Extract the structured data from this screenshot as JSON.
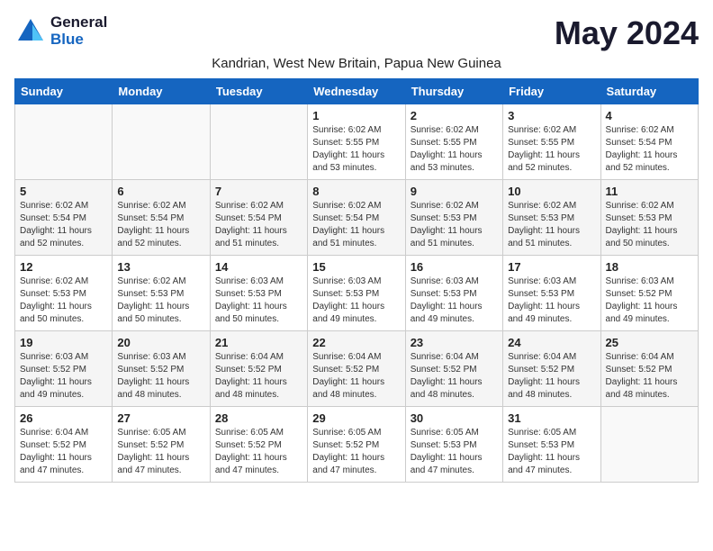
{
  "header": {
    "logo_general": "General",
    "logo_blue": "Blue",
    "month_title": "May 2024",
    "subtitle": "Kandrian, West New Britain, Papua New Guinea"
  },
  "weekdays": [
    "Sunday",
    "Monday",
    "Tuesday",
    "Wednesday",
    "Thursday",
    "Friday",
    "Saturday"
  ],
  "weeks": [
    [
      {
        "day": "",
        "info": ""
      },
      {
        "day": "",
        "info": ""
      },
      {
        "day": "",
        "info": ""
      },
      {
        "day": "1",
        "info": "Sunrise: 6:02 AM\nSunset: 5:55 PM\nDaylight: 11 hours and 53 minutes."
      },
      {
        "day": "2",
        "info": "Sunrise: 6:02 AM\nSunset: 5:55 PM\nDaylight: 11 hours and 53 minutes."
      },
      {
        "day": "3",
        "info": "Sunrise: 6:02 AM\nSunset: 5:55 PM\nDaylight: 11 hours and 52 minutes."
      },
      {
        "day": "4",
        "info": "Sunrise: 6:02 AM\nSunset: 5:54 PM\nDaylight: 11 hours and 52 minutes."
      }
    ],
    [
      {
        "day": "5",
        "info": "Sunrise: 6:02 AM\nSunset: 5:54 PM\nDaylight: 11 hours and 52 minutes."
      },
      {
        "day": "6",
        "info": "Sunrise: 6:02 AM\nSunset: 5:54 PM\nDaylight: 11 hours and 52 minutes."
      },
      {
        "day": "7",
        "info": "Sunrise: 6:02 AM\nSunset: 5:54 PM\nDaylight: 11 hours and 51 minutes."
      },
      {
        "day": "8",
        "info": "Sunrise: 6:02 AM\nSunset: 5:54 PM\nDaylight: 11 hours and 51 minutes."
      },
      {
        "day": "9",
        "info": "Sunrise: 6:02 AM\nSunset: 5:53 PM\nDaylight: 11 hours and 51 minutes."
      },
      {
        "day": "10",
        "info": "Sunrise: 6:02 AM\nSunset: 5:53 PM\nDaylight: 11 hours and 51 minutes."
      },
      {
        "day": "11",
        "info": "Sunrise: 6:02 AM\nSunset: 5:53 PM\nDaylight: 11 hours and 50 minutes."
      }
    ],
    [
      {
        "day": "12",
        "info": "Sunrise: 6:02 AM\nSunset: 5:53 PM\nDaylight: 11 hours and 50 minutes."
      },
      {
        "day": "13",
        "info": "Sunrise: 6:02 AM\nSunset: 5:53 PM\nDaylight: 11 hours and 50 minutes."
      },
      {
        "day": "14",
        "info": "Sunrise: 6:03 AM\nSunset: 5:53 PM\nDaylight: 11 hours and 50 minutes."
      },
      {
        "day": "15",
        "info": "Sunrise: 6:03 AM\nSunset: 5:53 PM\nDaylight: 11 hours and 49 minutes."
      },
      {
        "day": "16",
        "info": "Sunrise: 6:03 AM\nSunset: 5:53 PM\nDaylight: 11 hours and 49 minutes."
      },
      {
        "day": "17",
        "info": "Sunrise: 6:03 AM\nSunset: 5:53 PM\nDaylight: 11 hours and 49 minutes."
      },
      {
        "day": "18",
        "info": "Sunrise: 6:03 AM\nSunset: 5:52 PM\nDaylight: 11 hours and 49 minutes."
      }
    ],
    [
      {
        "day": "19",
        "info": "Sunrise: 6:03 AM\nSunset: 5:52 PM\nDaylight: 11 hours and 49 minutes."
      },
      {
        "day": "20",
        "info": "Sunrise: 6:03 AM\nSunset: 5:52 PM\nDaylight: 11 hours and 48 minutes."
      },
      {
        "day": "21",
        "info": "Sunrise: 6:04 AM\nSunset: 5:52 PM\nDaylight: 11 hours and 48 minutes."
      },
      {
        "day": "22",
        "info": "Sunrise: 6:04 AM\nSunset: 5:52 PM\nDaylight: 11 hours and 48 minutes."
      },
      {
        "day": "23",
        "info": "Sunrise: 6:04 AM\nSunset: 5:52 PM\nDaylight: 11 hours and 48 minutes."
      },
      {
        "day": "24",
        "info": "Sunrise: 6:04 AM\nSunset: 5:52 PM\nDaylight: 11 hours and 48 minutes."
      },
      {
        "day": "25",
        "info": "Sunrise: 6:04 AM\nSunset: 5:52 PM\nDaylight: 11 hours and 48 minutes."
      }
    ],
    [
      {
        "day": "26",
        "info": "Sunrise: 6:04 AM\nSunset: 5:52 PM\nDaylight: 11 hours and 47 minutes."
      },
      {
        "day": "27",
        "info": "Sunrise: 6:05 AM\nSunset: 5:52 PM\nDaylight: 11 hours and 47 minutes."
      },
      {
        "day": "28",
        "info": "Sunrise: 6:05 AM\nSunset: 5:52 PM\nDaylight: 11 hours and 47 minutes."
      },
      {
        "day": "29",
        "info": "Sunrise: 6:05 AM\nSunset: 5:52 PM\nDaylight: 11 hours and 47 minutes."
      },
      {
        "day": "30",
        "info": "Sunrise: 6:05 AM\nSunset: 5:53 PM\nDaylight: 11 hours and 47 minutes."
      },
      {
        "day": "31",
        "info": "Sunrise: 6:05 AM\nSunset: 5:53 PM\nDaylight: 11 hours and 47 minutes."
      },
      {
        "day": "",
        "info": ""
      }
    ]
  ]
}
